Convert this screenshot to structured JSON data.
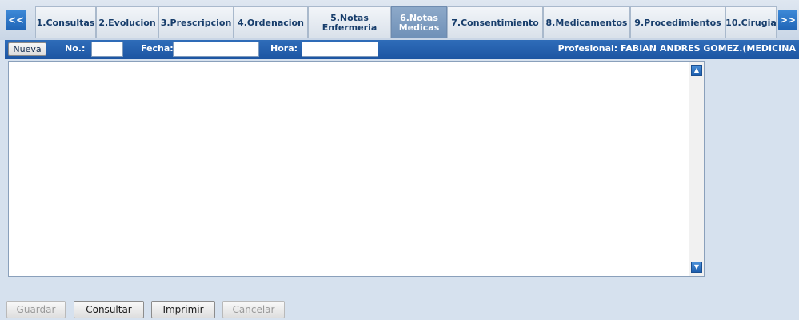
{
  "tabs_nav": {
    "prev": "<<",
    "next": ">>"
  },
  "tabs": [
    {
      "label": "1.Consultas"
    },
    {
      "label": "2.Evolucion"
    },
    {
      "label": "3.Prescripcion"
    },
    {
      "label": "4.Ordenacion"
    },
    {
      "label": "5.Notas Enfermeria"
    },
    {
      "label": "6.Notas Medicas",
      "active": true
    },
    {
      "label": "7.Consentimiento"
    },
    {
      "label": "8.Medicamentos"
    },
    {
      "label": "9.Procedimientos"
    },
    {
      "label": "10.Cirugia"
    }
  ],
  "toolbar": {
    "new_label": "Nueva",
    "no_label": "No.:",
    "no_value": "",
    "fecha_label": "Fecha:",
    "fecha_value": "",
    "hora_label": "Hora:",
    "hora_value": "",
    "profesional": "Profesional: FABIAN ANDRES GOMEZ.(MEDICINA"
  },
  "editor": {
    "value": "",
    "scroll_up": "▲",
    "scroll_down": "▼"
  },
  "footer": {
    "guardar": "Guardar",
    "consultar": "Consultar",
    "imprimir": "Imprimir",
    "cancelar": "Cancelar"
  },
  "colors": {
    "accent": "#1f64b6",
    "active_tab": "#7f9dc1",
    "toolbar": "#2563ad"
  }
}
